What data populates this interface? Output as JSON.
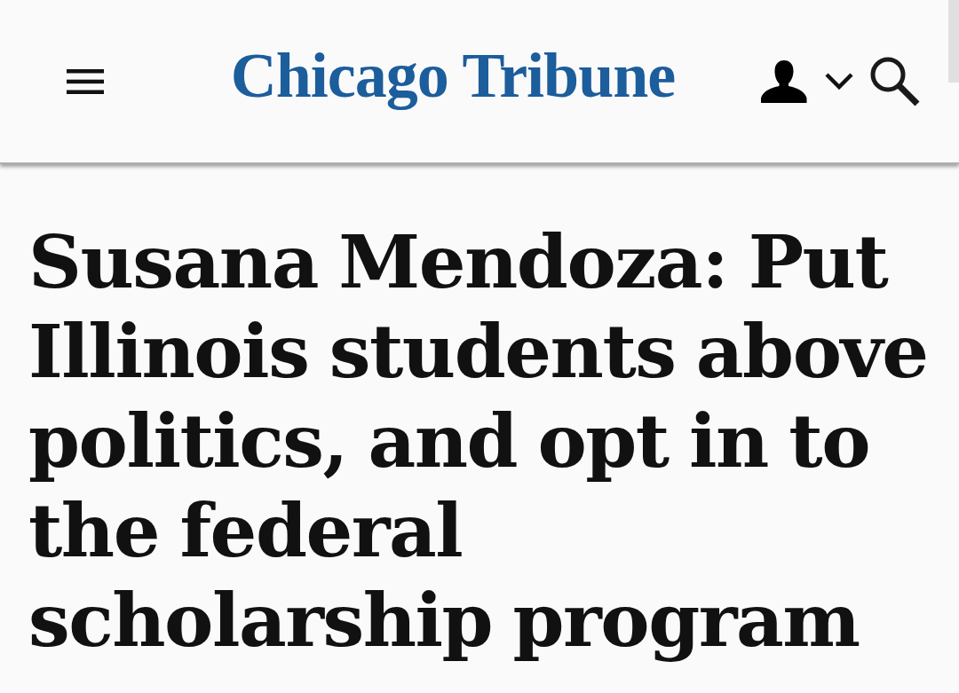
{
  "header": {
    "logo": "Chicago Tribune"
  },
  "headline": "Susana Mendoza: Put Illinois students above politics, and opt in to the federal scholarship program"
}
